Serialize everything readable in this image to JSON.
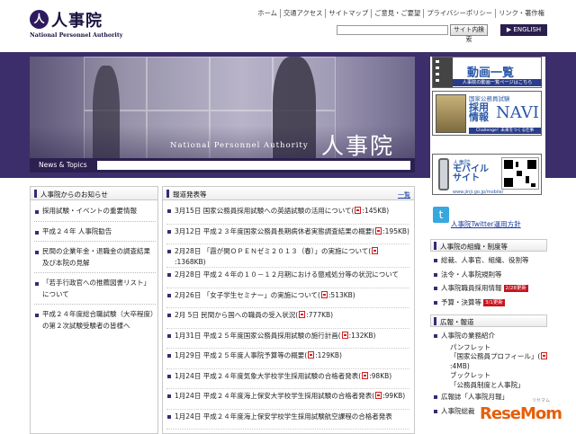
{
  "header": {
    "logo_mark": "人",
    "logo_jp": "人事院",
    "logo_en": "National Personnel Authority",
    "util_nav": [
      "ホーム",
      "交通アクセス",
      "サイトマップ",
      "ご意見・ご要望",
      "プライバシーポリシー",
      "リンク・著作権"
    ],
    "search_button": "サイト内検索",
    "english_button": "▶ ENGLISH"
  },
  "hero": {
    "subtitle_en": "National Personnel Authority",
    "title_jp": "人事院",
    "news_label": "News & Topics"
  },
  "widgets": {
    "video": {
      "title": "動画一覧",
      "sub": "人事院の動画一覧ページはこちら"
    },
    "navi": {
      "small": "国家公務員試験",
      "big": "採用\n情報",
      "navi": "NAVI",
      "bar": "Challenge！未来をつくる仕事"
    },
    "mobile": {
      "t1": "人事院",
      "t2": "モバイル\nサイト",
      "url": "www.jinji.go.jp/mobile/"
    },
    "twitter": {
      "icon": "t",
      "text": "人事院Twitter運用方針"
    }
  },
  "left_panel": {
    "title": "人事院からのお知らせ",
    "items": [
      "採用試験・イベントの重要情報",
      "平成２４年 人事院勧告",
      "民間の企業年金・退職金の調査結果及び本院の見解",
      "「若手行政官への推薦図書リスト」について",
      "平成２４年度総合職試験（大卒程度）の第２次試験受験者の皆様へ"
    ]
  },
  "press": {
    "title": "報道発表等",
    "more": "一覧",
    "items": [
      {
        "text": "3月15日 国家公務員採用試験への英語試験の活用について(",
        "size": ":145KB)"
      },
      {
        "text": "3月12日 平成２３年度国家公務員長期病休者実態調査結果の概要(",
        "size": ":195KB)"
      },
      {
        "text": "2月28日 「霞が関ＯＰＥＮゼミ２０１３（春）」の実施について(",
        "size": ":1368KB)"
      },
      {
        "text": "2月28日 平成２４年の１０－１２月期における懲戒処分等の状況について",
        "size": ""
      },
      {
        "text": "2月26日 「女子学生セミナー」の実施について(",
        "size": ":513KB)"
      },
      {
        "text": "2月 5日 民間から国への職員の受入状況(",
        "size": ":777KB)"
      },
      {
        "text": "1月31日 平成２５年度国家公務員採用試験の施行計画(",
        "size": ":132KB)"
      },
      {
        "text": "1月29日 平成２５年度人事院予算等の概要(",
        "size": ":129KB)"
      },
      {
        "text": "1月24日 平成２４年度気象大学校学生採用試験の合格者発表(",
        "size": ":98KB)"
      },
      {
        "text": "1月24日 平成２４年度海上保安大学校学生採用試験の合格者発表(",
        "size": ":99KB)"
      },
      {
        "text": "1月24日 平成２４年度海上保安学校学生採用試験航空課程の合格者発表",
        "size": ""
      }
    ]
  },
  "right_sections": {
    "org": {
      "title": "人事院の組織・制度等",
      "items": [
        {
          "text": "総裁、人事官、組織、役割等",
          "badge": ""
        },
        {
          "text": "法令・人事院規則等",
          "badge": ""
        },
        {
          "text": "人事院職員採用情報",
          "badge": "2/28更新"
        },
        {
          "text": "予算・決算等",
          "badge": "3/1更新"
        }
      ]
    },
    "pr": {
      "title": "広報・報道",
      "items": [
        {
          "text": "人事院の業務紹介",
          "sub": false
        },
        {
          "text": "パンフレット",
          "sub": true
        },
        {
          "text": "「国家公務員プロフィール」(",
          "sub": true,
          "pdf": true
        },
        {
          "text": ":4MB)",
          "sub": true
        },
        {
          "text": "ブックレット",
          "sub": true
        },
        {
          "text": "「公務員制度と人事院」",
          "sub": true
        },
        {
          "text": "広報誌「人事院月報」",
          "sub": false
        },
        {
          "text": "人事院総裁",
          "sub": false
        }
      ]
    }
  },
  "watermark": {
    "text": "ReseMom",
    "small": "リセマム"
  }
}
